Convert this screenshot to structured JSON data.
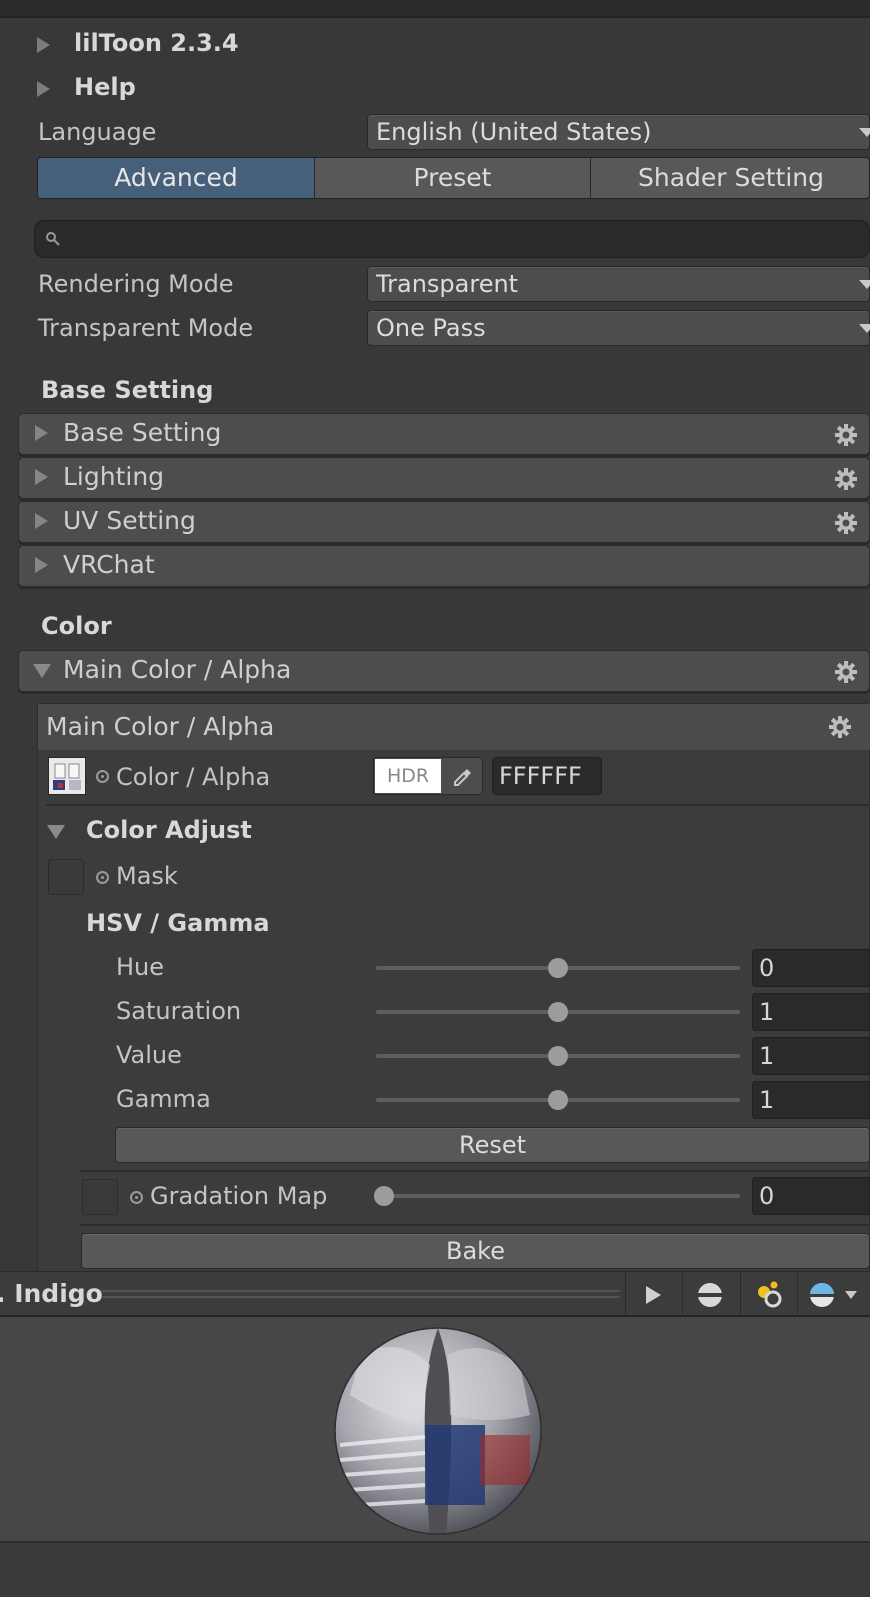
{
  "header": {
    "liltoon_label": "lilToon 2.3.4",
    "help_label": "Help",
    "language_label": "Language",
    "language_value": "English (United States)"
  },
  "tabs": [
    {
      "label": "Advanced",
      "active": true
    },
    {
      "label": "Preset",
      "active": false
    },
    {
      "label": "Shader Setting",
      "active": false
    }
  ],
  "search": {
    "value": ""
  },
  "rendering": {
    "rendering_mode_label": "Rendering Mode",
    "rendering_mode_value": "Transparent",
    "transparent_mode_label": "Transparent Mode",
    "transparent_mode_value": "One Pass"
  },
  "base_section": {
    "title": "Base Setting",
    "panels": [
      {
        "label": "Base Setting",
        "gear": true
      },
      {
        "label": "Lighting",
        "gear": true
      },
      {
        "label": "UV Setting",
        "gear": true
      },
      {
        "label": "VRChat",
        "gear": false
      }
    ]
  },
  "color_section": {
    "title": "Color",
    "main_panel_label": "Main Color / Alpha",
    "inner_header": "Main Color / Alpha",
    "color_alpha_label": "Color / Alpha",
    "hdr_label": "HDR",
    "hex_value": "FFFFFF",
    "color_adjust_label": "Color Adjust",
    "mask_label": "Mask",
    "hsv_title": "HSV / Gamma",
    "sliders": [
      {
        "label": "Hue",
        "value": "0",
        "fraction": 0.5
      },
      {
        "label": "Saturation",
        "value": "1",
        "fraction": 0.5
      },
      {
        "label": "Value",
        "value": "1",
        "fraction": 0.5
      },
      {
        "label": "Gamma",
        "value": "1",
        "fraction": 0.5
      }
    ],
    "reset_label": "Reset",
    "gradation_label": "Gradation Map",
    "gradation_value": "0",
    "gradation_fraction": 0.0,
    "bake_label": "Bake"
  },
  "preview": {
    "title": ". Indigo"
  },
  "colors": {
    "accent_tab": "#46607c",
    "background": "#383838"
  }
}
